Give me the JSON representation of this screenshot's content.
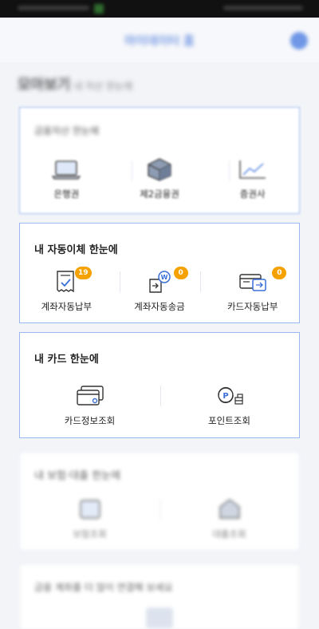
{
  "header": {
    "title": "마이데이터 홈",
    "menu_icon": "hamburger-menu-icon"
  },
  "page": {
    "heading": "모아보기",
    "heading_sub": "내 자산 한눈에"
  },
  "section_assets": {
    "title": "금융자산 한눈에",
    "items": [
      {
        "label": "은행권",
        "icon": "bank-laptop-icon"
      },
      {
        "label": "제2금융권",
        "icon": "cube-icon"
      },
      {
        "label": "증권사",
        "icon": "stock-chart-icon"
      }
    ]
  },
  "section_autotransfer": {
    "title": "내 자동이체 한눈에",
    "items": [
      {
        "label": "계좌자동납부",
        "badge": "19",
        "icon": "receipt-check-icon"
      },
      {
        "label": "계좌자동송금",
        "badge": "0",
        "icon": "won-transfer-icon"
      },
      {
        "label": "카드자동납부",
        "badge": "0",
        "icon": "card-transfer-icon"
      }
    ]
  },
  "section_card": {
    "title": "내 카드 한눈에",
    "items": [
      {
        "label": "카드정보조회",
        "icon": "credit-card-icon"
      },
      {
        "label": "포인트조회",
        "icon": "point-coins-icon"
      }
    ]
  },
  "section_insurance": {
    "title": "내 보험·대출 한눈에",
    "items": [
      {
        "label": "보험조회",
        "icon": "insurance-icon"
      },
      {
        "label": "대출조회",
        "icon": "loan-icon"
      }
    ]
  },
  "section_bottom": {
    "title": "금융 계좌를 더 많이 연결해 보세요"
  },
  "colors": {
    "accent": "#3b6fd8",
    "badge": "#f5a100",
    "card_border": "#9bb8ee",
    "icon_stroke": "#333333"
  }
}
